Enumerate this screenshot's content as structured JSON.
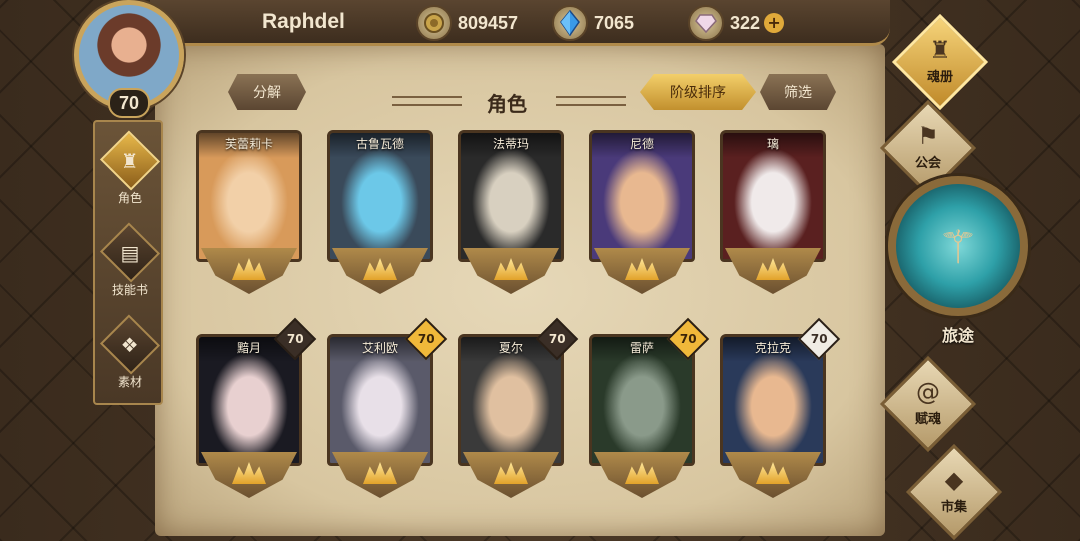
{
  "player": {
    "name": "Raphdel",
    "level": "70"
  },
  "resources": [
    {
      "icon": "gold-coin-icon",
      "value": "809457"
    },
    {
      "icon": "blue-crystal-icon",
      "value": "7065"
    },
    {
      "icon": "gem-icon",
      "value": "322"
    }
  ],
  "left_tabs": [
    {
      "label": "角色",
      "icon": "helmet-icon",
      "active": true
    },
    {
      "label": "技能书",
      "icon": "skill-book-icon",
      "active": false
    },
    {
      "label": "素材",
      "icon": "material-icon",
      "active": false
    }
  ],
  "panel": {
    "title": "角色",
    "decompose_label": "分解",
    "sort_label": "阶级排序",
    "filter_label": "筛选"
  },
  "characters_row1": [
    {
      "name": "芙蕾莉卡",
      "level": "",
      "lvl_style": "none",
      "colors": [
        "#d89a5a",
        "#f2d0a8"
      ]
    },
    {
      "name": "古鲁瓦德",
      "level": "",
      "lvl_style": "none",
      "colors": [
        "#3a4a5a",
        "#6cc8e8"
      ]
    },
    {
      "name": "法蒂玛",
      "level": "",
      "lvl_style": "none",
      "colors": [
        "#2a2a2a",
        "#d8d0c0"
      ]
    },
    {
      "name": "尼德",
      "level": "",
      "lvl_style": "none",
      "colors": [
        "#4a3a7a",
        "#e8b890"
      ]
    },
    {
      "name": "璃",
      "level": "",
      "lvl_style": "none",
      "colors": [
        "#5a2020",
        "#f0eaea"
      ]
    }
  ],
  "characters_row2": [
    {
      "name": "黯月",
      "level": "70",
      "lvl_style": "dark",
      "colors": [
        "#1a1a22",
        "#e8d0d0"
      ]
    },
    {
      "name": "艾利欧",
      "level": "70",
      "lvl_style": "gold",
      "colors": [
        "#5a5a6a",
        "#e8e0e8"
      ]
    },
    {
      "name": "夏尔",
      "level": "70",
      "lvl_style": "dark",
      "colors": [
        "#3a3a3a",
        "#e0c0a0"
      ]
    },
    {
      "name": "雷萨",
      "level": "70",
      "lvl_style": "gold",
      "colors": [
        "#2a3a2a",
        "#8a9a8a"
      ]
    },
    {
      "name": "克拉克",
      "level": "70",
      "lvl_style": "white",
      "colors": [
        "#2a3a5a",
        "#e8b890"
      ]
    }
  ],
  "right_menu": {
    "soul_book": "魂册",
    "guild": "公会",
    "journey": "旅途",
    "endow_soul": "赋魂",
    "market": "市集"
  }
}
